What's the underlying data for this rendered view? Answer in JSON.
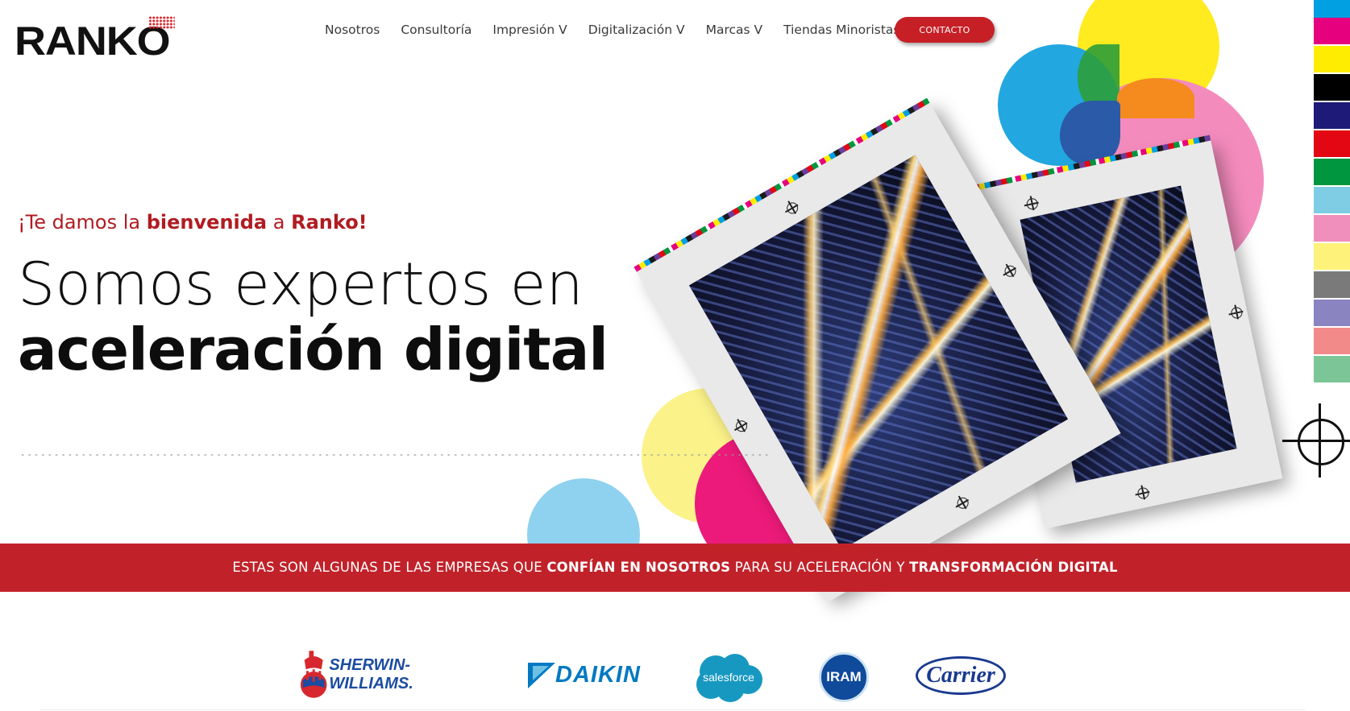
{
  "header": {
    "logo": "RANKO",
    "nav": [
      {
        "label": "Nosotros"
      },
      {
        "label": "Consultoría"
      },
      {
        "label": "Impresión V"
      },
      {
        "label": "Digitalización V"
      },
      {
        "label": "Marcas V"
      },
      {
        "label": "Tiendas Minoristas"
      }
    ],
    "contact_label": "CONTACTO"
  },
  "hero": {
    "welcome_prefix": "¡Te damos la ",
    "welcome_bold": "bienvenida",
    "welcome_mid": " a ",
    "welcome_brand": "Ranko!",
    "headline_line1": "Somos expertos en",
    "headline_line2": "aceleración digital"
  },
  "banner": {
    "part1": "ESTAS SON ALGUNAS DE LAS EMPRESAS QUE ",
    "part2": "CONFÍAN EN NOSOTROS",
    "part3": " PARA SU ACELERACIÓN Y ",
    "part4": "TRANSFORMACIÓN DIGITAL"
  },
  "clients": [
    {
      "name": "SHERWIN-WILLIAMS.",
      "icon": "sherwin-williams-logo"
    },
    {
      "name": "DAIKIN",
      "icon": "daikin-logo"
    },
    {
      "name": "salesforce",
      "icon": "salesforce-logo"
    },
    {
      "name": "IRAM",
      "icon": "iram-logo"
    },
    {
      "name": "Carrier",
      "icon": "carrier-logo"
    }
  ],
  "colors": {
    "brand_red": "#c1222a",
    "cmyk_swatches": [
      "#00a0e3",
      "#e6007e",
      "#ffed00",
      "#000000",
      "#1d1a78",
      "#e30613",
      "#00963f",
      "#7fcde5",
      "#f08fbc",
      "#fff27a",
      "#7a7a7a",
      "#8a84c0",
      "#f28a8a",
      "#7cc596"
    ]
  }
}
